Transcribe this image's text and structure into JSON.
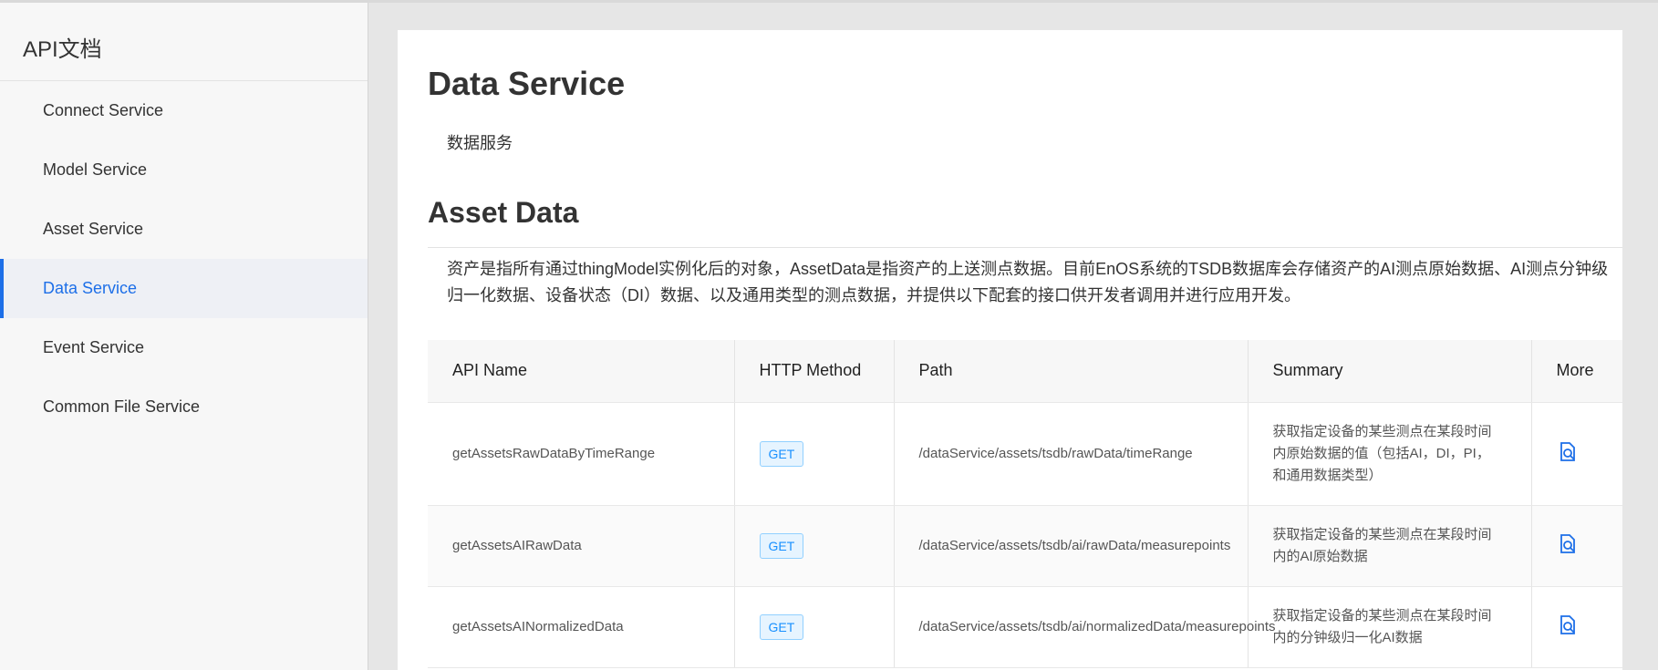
{
  "sidebar": {
    "title": "API文档",
    "items": [
      {
        "label": "Connect Service",
        "active": false
      },
      {
        "label": "Model Service",
        "active": false
      },
      {
        "label": "Asset Service",
        "active": false
      },
      {
        "label": "Data Service",
        "active": true
      },
      {
        "label": "Event Service",
        "active": false
      },
      {
        "label": "Common File Service",
        "active": false
      }
    ]
  },
  "main": {
    "title": "Data Service",
    "description": "数据服务",
    "section": {
      "title": "Asset Data",
      "description": "资产是指所有通过thingModel实例化后的对象，AssetData是指资产的上送测点数据。目前EnOS系统的TSDB数据库会存储资产的AI测点原始数据、AI测点分钟级归一化数据、设备状态（DI）数据、以及通用类型的测点数据，并提供以下配套的接口供开发者调用并进行应用开发。"
    },
    "table": {
      "headers": {
        "name": "API Name",
        "method": "HTTP Method",
        "path": "Path",
        "summary": "Summary",
        "more": "More"
      },
      "rows": [
        {
          "name": "getAssetsRawDataByTimeRange",
          "method": "GET",
          "path": "/dataService/assets/tsdb/rawData/timeRange",
          "summary": "获取指定设备的某些测点在某段时间内原始数据的值（包括AI，DI，PI，和通用数据类型）",
          "more_icon": "search-document-icon"
        },
        {
          "name": "getAssetsAIRawData",
          "method": "GET",
          "path": "/dataService/assets/tsdb/ai/rawData/measurepoints",
          "summary": "获取指定设备的某些测点在某段时间内的AI原始数据",
          "more_icon": "search-document-icon"
        },
        {
          "name": "getAssetsAINormalizedData",
          "method": "GET",
          "path": "/dataService/assets/tsdb/ai/normalizedData/measurepoints",
          "summary": "获取指定设备的某些测点在某段时间内的分钟级归一化AI数据",
          "more_icon": "search-document-icon"
        }
      ]
    }
  },
  "colors": {
    "accent": "#1d6fe8",
    "badge_text": "#1890ff",
    "badge_bg": "#e6f4ff"
  }
}
